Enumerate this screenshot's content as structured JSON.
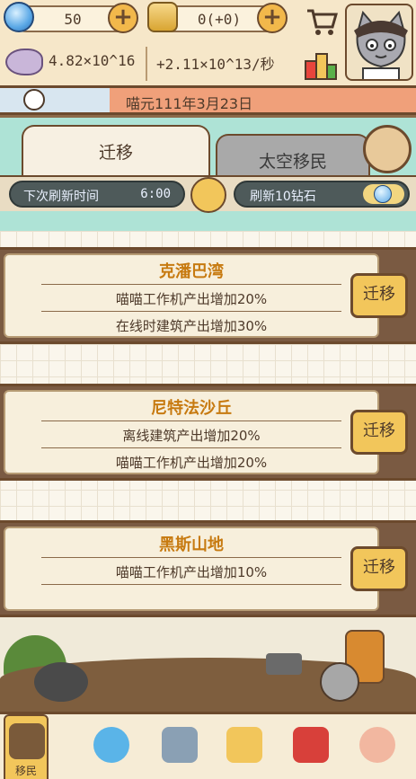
{
  "resources": {
    "gems": "50",
    "scrolls": "0(+0)",
    "fish_total": "4.82×10^16",
    "fish_rate": "+2.11×10^13/秒"
  },
  "date": {
    "text": "喵元111年3月23日"
  },
  "tabs": [
    {
      "label": "迁移",
      "active": true
    },
    {
      "label": "太空移民",
      "active": false
    }
  ],
  "refresh": {
    "label": "下次刷新时间",
    "time": "6:00",
    "gem_label": "刷新10钻石"
  },
  "destinations": [
    {
      "title": "克潘巴湾",
      "effects": [
        "喵喵工作机产出增加20%",
        "在线时建筑产出增加30%"
      ],
      "button": "迁移"
    },
    {
      "title": "尼特法沙丘",
      "effects": [
        "离线建筑产出增加20%",
        "喵喵工作机产出增加20%"
      ],
      "button": "迁移"
    },
    {
      "title": "黑斯山地",
      "effects": [
        "喵喵工作机产出增加10%"
      ],
      "button": "迁移"
    }
  ],
  "bottom_nav": [
    {
      "label": "移民",
      "icon": "cart-wagon-icon",
      "active": true
    },
    {
      "label": "",
      "icon": "potion-icon",
      "active": false
    },
    {
      "label": "",
      "icon": "bank-icon",
      "active": false
    },
    {
      "label": "",
      "icon": "treasure-chest-icon",
      "active": false
    },
    {
      "label": "",
      "icon": "red-book-icon",
      "active": false
    },
    {
      "label": "",
      "icon": "cats-icon",
      "active": false
    }
  ],
  "colors": {
    "accent": "#f2c65b",
    "border": "#6c4a2d",
    "card_title": "#c77a10",
    "date_bar": "#f0a07a",
    "sky": "#aee3d6"
  }
}
